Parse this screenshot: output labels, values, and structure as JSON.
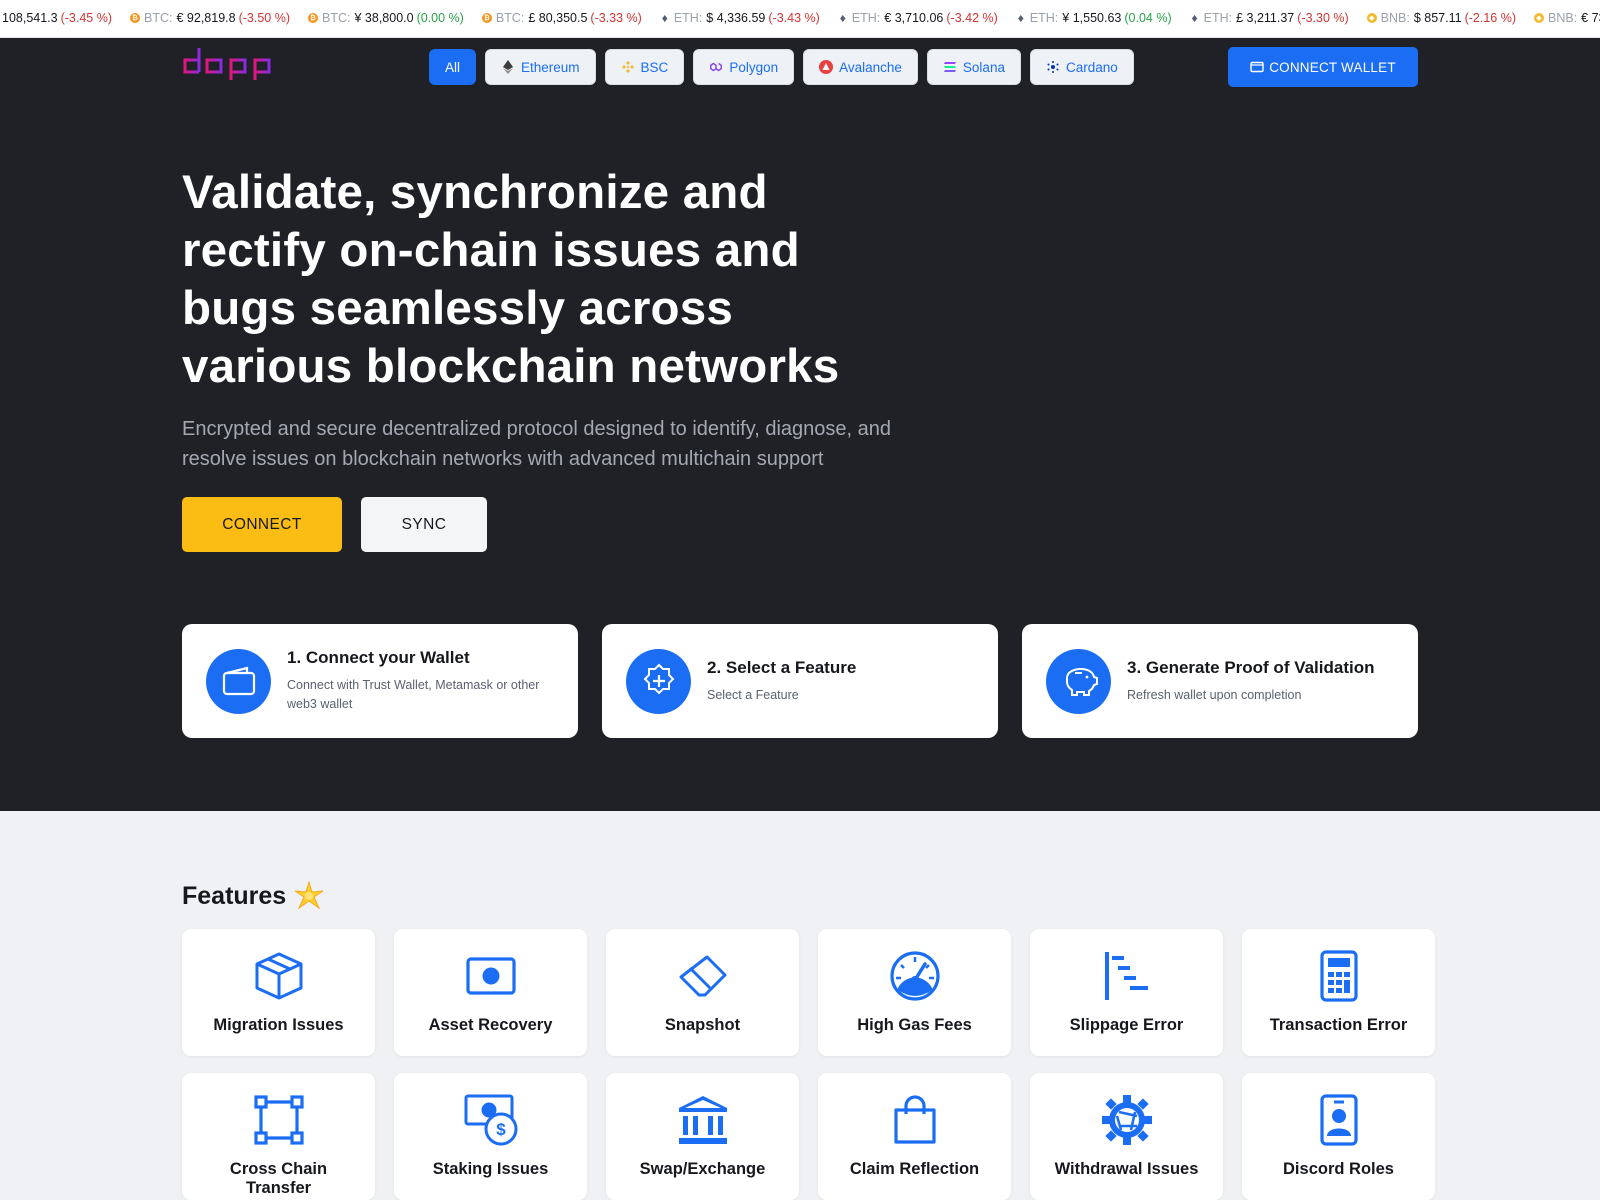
{
  "ticker": [
    {
      "coin": "",
      "symbol": "",
      "price": "108,541.3",
      "change": "(-3.45 %)",
      "trend": "neg"
    },
    {
      "coin": "btc",
      "symbol": "BTC:",
      "price": "€ 92,819.8",
      "change": "(-3.50 %)",
      "trend": "neg"
    },
    {
      "coin": "btc",
      "symbol": "BTC:",
      "price": "¥ 38,800.0",
      "change": "(0.00 %)",
      "trend": "pos"
    },
    {
      "coin": "btc",
      "symbol": "BTC:",
      "price": "£ 80,350.5",
      "change": "(-3.33 %)",
      "trend": "neg"
    },
    {
      "coin": "eth",
      "symbol": "ETH:",
      "price": "$ 4,336.59",
      "change": "(-3.43 %)",
      "trend": "neg"
    },
    {
      "coin": "eth",
      "symbol": "ETH:",
      "price": "€ 3,710.06",
      "change": "(-3.42 %)",
      "trend": "neg"
    },
    {
      "coin": "eth",
      "symbol": "ETH:",
      "price": "¥ 1,550.63",
      "change": "(0.04 %)",
      "trend": "pos"
    },
    {
      "coin": "eth",
      "symbol": "ETH:",
      "price": "£ 3,211.37",
      "change": "(-3.30 %)",
      "trend": "neg"
    },
    {
      "coin": "bnb",
      "symbol": "BNB:",
      "price": "$ 857.11",
      "change": "(-2.16 %)",
      "trend": "neg"
    },
    {
      "coin": "bnb",
      "symbol": "BNB:",
      "price": "€ 73",
      "change": "",
      "trend": "neg"
    }
  ],
  "header": {
    "logo_text": "dapp",
    "chain_tabs": [
      {
        "label": "All",
        "icon": "none",
        "active": true
      },
      {
        "label": "Ethereum",
        "icon": "ethereum-icon"
      },
      {
        "label": "BSC",
        "icon": "bsc-icon"
      },
      {
        "label": "Polygon",
        "icon": "polygon-icon"
      },
      {
        "label": "Avalanche",
        "icon": "avalanche-icon"
      },
      {
        "label": "Solana",
        "icon": "solana-icon"
      },
      {
        "label": "Cardano",
        "icon": "cardano-icon"
      }
    ],
    "connect_wallet_label": "CONNECT WALLET"
  },
  "hero": {
    "headline": "Validate, synchronize and rectify on-chain issues and bugs seamlessly across various blockchain networks",
    "subline": "Encrypted and secure decentralized protocol designed to identify, diagnose, and resolve issues on blockchain networks with advanced multichain support",
    "connect_label": "CONNECT",
    "sync_label": "SYNC"
  },
  "steps": [
    {
      "title": "1. Connect your Wallet",
      "desc": "Connect with Trust Wallet, Metamask or other web3 wallet",
      "icon": "wallet-icon"
    },
    {
      "title": "2. Select a Feature",
      "desc": "Select a Feature",
      "icon": "plus-badge-icon"
    },
    {
      "title": "3. Generate Proof of Validation",
      "desc": "Refresh wallet upon completion",
      "icon": "piggy-bank-icon"
    }
  ],
  "features": {
    "title": "Features",
    "items": [
      {
        "label": "Migration Issues",
        "icon": "box-icon"
      },
      {
        "label": "Asset Recovery",
        "icon": "record-icon"
      },
      {
        "label": "Snapshot",
        "icon": "eraser-icon"
      },
      {
        "label": "High Gas Fees",
        "icon": "speedometer-icon"
      },
      {
        "label": "Slippage Error",
        "icon": "bar-list-icon"
      },
      {
        "label": "Transaction Error",
        "icon": "calculator-icon"
      },
      {
        "label": "Cross Chain Transfer",
        "icon": "bounding-box-icon"
      },
      {
        "label": "Staking Issues",
        "icon": "cash-coin-icon"
      },
      {
        "label": "Swap/Exchange",
        "icon": "bank-icon"
      },
      {
        "label": "Claim Reflection",
        "icon": "bag-icon"
      },
      {
        "label": "Withdrawal Issues",
        "icon": "gear-shutter-icon"
      },
      {
        "label": "Discord Roles",
        "icon": "badge-icon"
      }
    ]
  },
  "colors": {
    "accent": "#1b6ef3",
    "dark_bg": "#1f2126",
    "yellow": "#fbbc14",
    "negative": "#d23434",
    "positive": "#2aa24a"
  }
}
